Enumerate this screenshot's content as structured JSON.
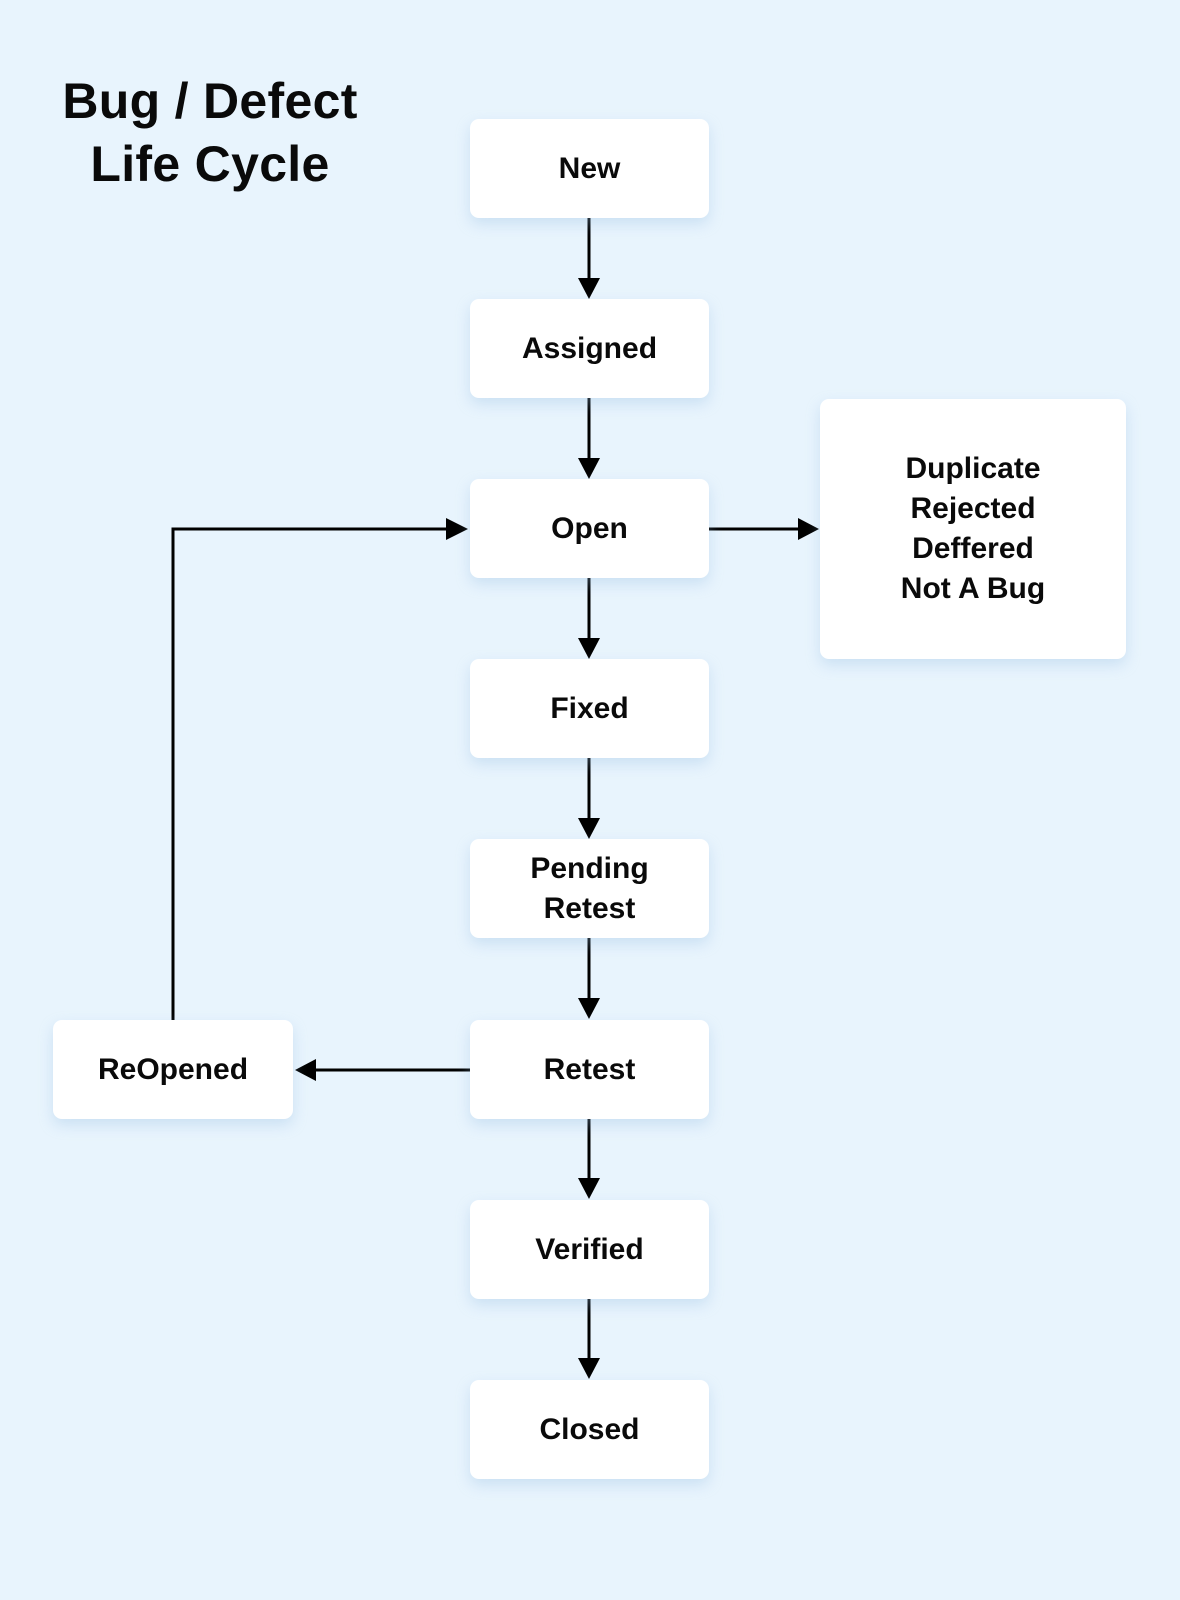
{
  "title": {
    "line1": "Bug / Defect",
    "line2": "Life Cycle"
  },
  "states": {
    "new": "New",
    "assigned": "Assigned",
    "open": "Open",
    "fixed": "Fixed",
    "pending_retest": [
      "Pending",
      "Retest"
    ],
    "retest": "Retest",
    "verified": "Verified",
    "closed": "Closed",
    "reopened": "ReOpened",
    "terminal_alternatives": [
      "Duplicate",
      "Rejected",
      "Deffered",
      "Not A Bug"
    ]
  },
  "transitions": [
    {
      "from": "New",
      "to": "Assigned"
    },
    {
      "from": "Assigned",
      "to": "Open"
    },
    {
      "from": "Open",
      "to": "Fixed"
    },
    {
      "from": "Open",
      "to": "Duplicate / Rejected / Deffered / Not A Bug"
    },
    {
      "from": "Fixed",
      "to": "Pending Retest"
    },
    {
      "from": "Pending Retest",
      "to": "Retest"
    },
    {
      "from": "Retest",
      "to": "Verified"
    },
    {
      "from": "Retest",
      "to": "ReOpened"
    },
    {
      "from": "ReOpened",
      "to": "Open"
    },
    {
      "from": "Verified",
      "to": "Closed"
    }
  ],
  "colors": {
    "background": "#e8f4fd",
    "box": "#ffffff",
    "text": "#0a0a0a",
    "arrow": "#000000"
  }
}
